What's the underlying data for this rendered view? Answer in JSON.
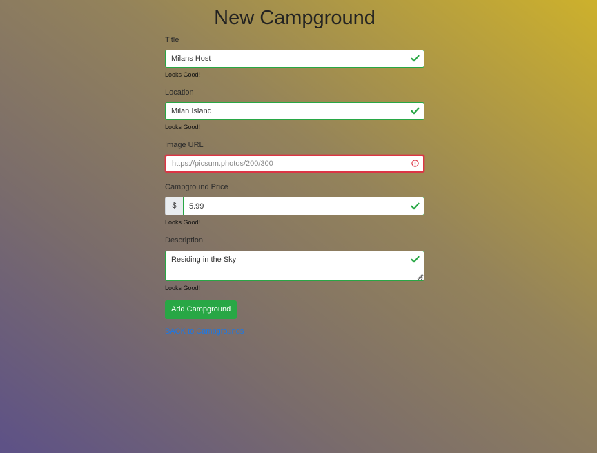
{
  "page": {
    "title": "New Campground"
  },
  "form": {
    "title_field": {
      "label": "Title",
      "value": "Milans Host",
      "feedback": "Looks Good!",
      "status": "valid"
    },
    "location_field": {
      "label": "Location",
      "value": "Milan Island",
      "feedback": "Looks Good!",
      "status": "valid"
    },
    "image_field": {
      "label": "Image URL",
      "value": "",
      "placeholder": "https://picsum.photos/200/300",
      "status": "invalid"
    },
    "price_field": {
      "label": "Campground Price",
      "addon": "$",
      "value": "5.99",
      "feedback": "Looks Good!",
      "status": "valid"
    },
    "description_field": {
      "label": "Description",
      "value": "Residing in the Sky",
      "feedback": "Looks Good!",
      "status": "valid"
    },
    "submit_label": "Add Campground",
    "back_link": "BACK to Campgrounds"
  },
  "colors": {
    "valid": "#28a745",
    "invalid": "#dc3545",
    "link": "#1b78e6"
  },
  "icons": {
    "valid": "check-icon",
    "invalid": "alert-circle-icon"
  }
}
